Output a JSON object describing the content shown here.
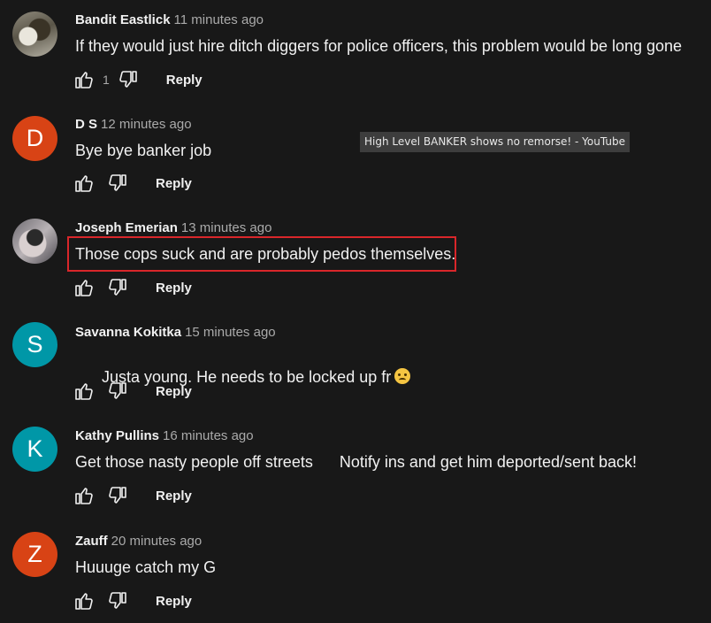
{
  "tooltip": "High Level BANKER shows no remorse! - YouTube",
  "comments": [
    {
      "author": "Bandit Eastlick",
      "time": "11 minutes ago",
      "text": "If they would just hire ditch diggers for police officers, this problem would be long gone",
      "likes": "1",
      "reply": "Reply",
      "avatar_letter": "",
      "avatar_color": "#6b6658"
    },
    {
      "author": "D S",
      "time": "12 minutes ago",
      "text": "Bye bye banker job",
      "likes": "",
      "reply": "Reply",
      "avatar_letter": "D",
      "avatar_color": "#d84315"
    },
    {
      "author": "Joseph Emerian",
      "time": "13 minutes ago",
      "text": "Those cops suck and are probably pedos themselves.",
      "likes": "",
      "reply": "Reply",
      "avatar_letter": "",
      "avatar_color": "#8a868c"
    },
    {
      "author": "Savanna Kokitka",
      "time": "15 minutes ago",
      "text": "Justa young. He needs to be locked up fr",
      "likes": "",
      "reply": "Reply",
      "avatar_letter": "S",
      "avatar_color": "#0097a7"
    },
    {
      "author": "Kathy Pullins",
      "time": "16 minutes ago",
      "text": "Get those nasty people off streets      Notify ins and get him deported/sent back!",
      "likes": "",
      "reply": "Reply",
      "avatar_letter": "K",
      "avatar_color": "#0097a7"
    },
    {
      "author": "Zauff",
      "time": "20 minutes ago",
      "text": "Huuuge catch my G",
      "likes": "",
      "reply": "Reply",
      "avatar_letter": "Z",
      "avatar_color": "#d84315"
    }
  ],
  "icons": {
    "like": "thumbs-up-icon",
    "dislike": "thumbs-down-icon",
    "emoji": "crying-face-emoji-icon"
  },
  "colors": {
    "background": "#181818",
    "highlight_border": "#d9262a",
    "secondary_text": "#aaaaaa"
  }
}
